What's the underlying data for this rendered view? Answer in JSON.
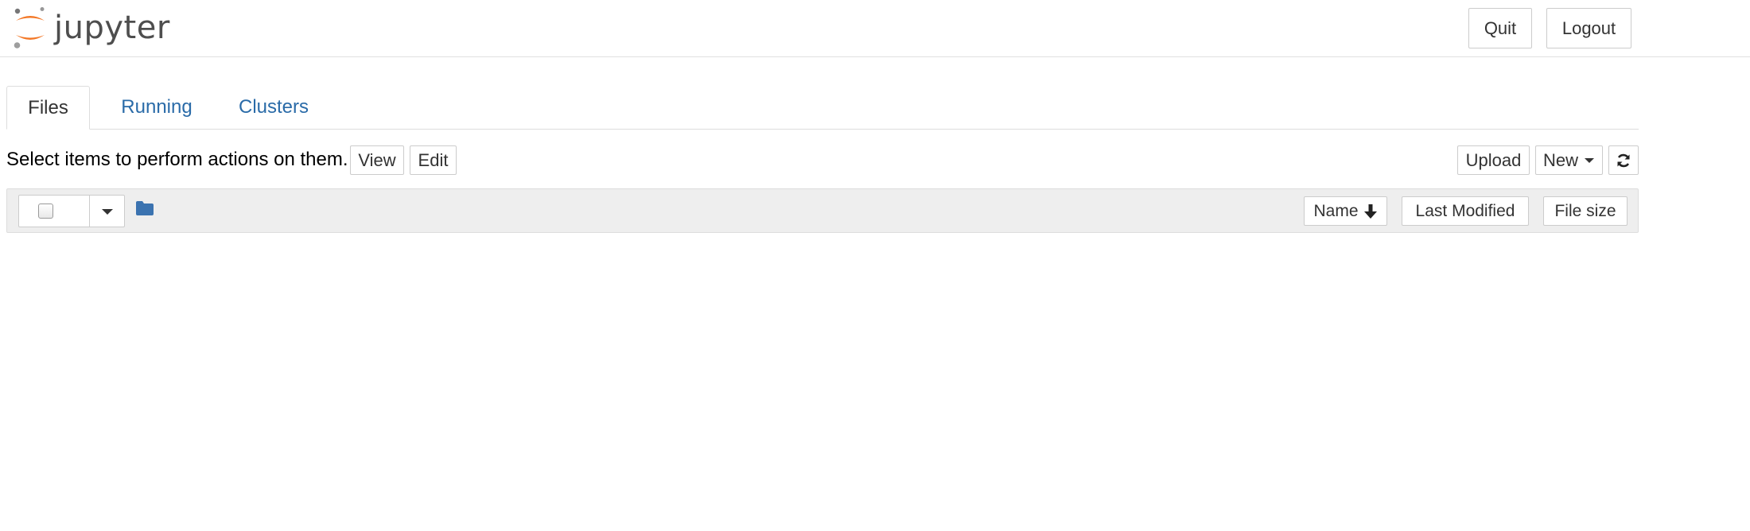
{
  "header": {
    "logo_text": "jupyter",
    "quit_label": "Quit",
    "logout_label": "Logout"
  },
  "tabs": [
    {
      "label": "Files",
      "active": true
    },
    {
      "label": "Running",
      "active": false
    },
    {
      "label": "Clusters",
      "active": false
    }
  ],
  "toolbar": {
    "hint_text": "Select items to perform actions on them.",
    "view_label": "View",
    "edit_label": "Edit",
    "upload_label": "Upload",
    "new_label": "New",
    "refresh_icon": "refresh-icon"
  },
  "list_header": {
    "name_label": "Name",
    "last_modified_label": "Last Modified",
    "file_size_label": "File size",
    "folder_icon": "folder-icon"
  },
  "colors": {
    "link": "#2a6ba8",
    "logo_orange": "#f37726",
    "logo_gray": "#616262",
    "folder_blue": "#3b73b0",
    "list_header_bg": "#eeeeee"
  }
}
